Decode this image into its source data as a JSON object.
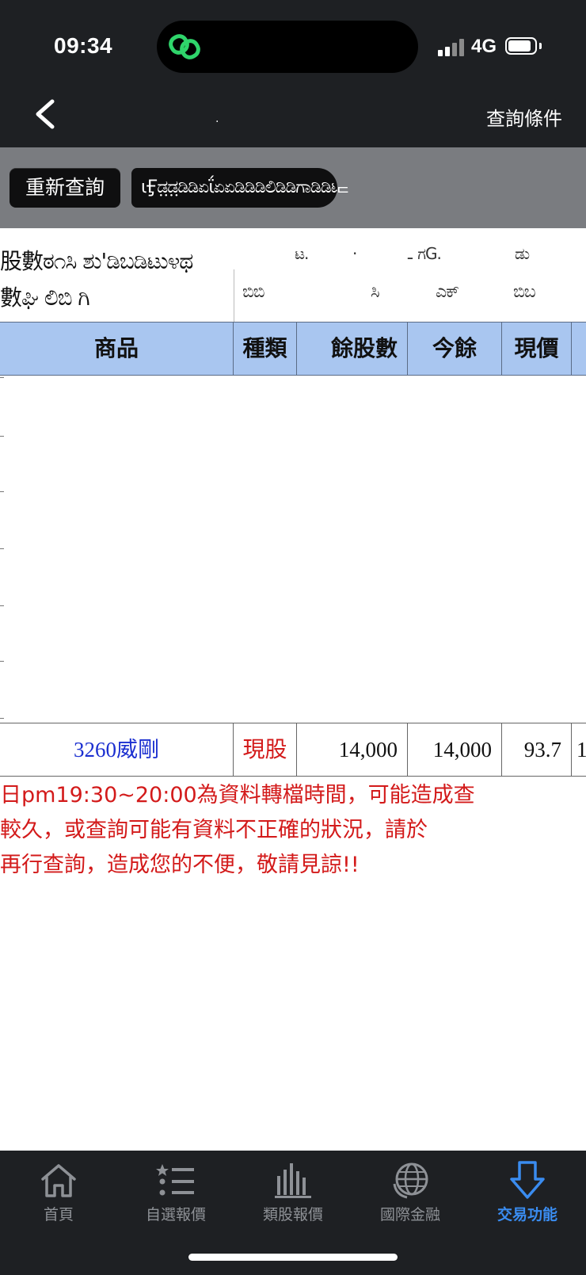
{
  "status_bar": {
    "time": "09:34",
    "network": "4G",
    "signal_icon": "signal-bars-icon",
    "battery_icon": "battery-icon",
    "app_icon": "link-chain-icon"
  },
  "nav": {
    "back_icon": "chevron-left-icon",
    "title": ".",
    "query_conditions": "查詢條件"
  },
  "actions": {
    "requery": "重新查詢",
    "account": "ιӺಡ಼ಡ಼ಡಿಡಿಏΐಏಏಡಿಡಿಡಿಲಿಡಿಡಿಗಾಡಿಡಿಟಿ",
    "account_tail": "ᄃ"
  },
  "summary": {
    "row1_left": "股數ಠ೧ಸಿ ಶು'ಡಿಬಡಿಟು೪ಥ",
    "row1_right": [
      "ಟ.",
      "·",
      "ـ ಗG.",
      "ಡು"
    ],
    "row2_left": "數ಘಿ  ಲಿಬಿ ಗಿ",
    "row2_right": [
      "ಬಿಬಿ",
      "ಸಿ",
      "ಎಕ್",
      "ಬಿಬ"
    ]
  },
  "table": {
    "headers": [
      "商品",
      "種類",
      "餘股數",
      "今餘",
      "現價",
      ""
    ],
    "rows": [
      {
        "product": "3260威剛",
        "kind": "現股",
        "remaining_shares": "14,000",
        "today_remaining": "14,000",
        "price": "93.7",
        "extra": "1"
      }
    ]
  },
  "notice": {
    "lines": [
      "日pm19:30~20:00為資料轉檔時間，可能造成查",
      "較久，或查詢可能有資料不正確的狀況，請於",
      "再行查詢，造成您的不便，敬請見諒!!"
    ]
  },
  "tabbar": {
    "items": [
      {
        "label": "首頁",
        "icon": "home-icon",
        "active": false
      },
      {
        "label": "自選報價",
        "icon": "star-list-icon",
        "active": false
      },
      {
        "label": "類股報價",
        "icon": "bar-chart-icon",
        "active": false
      },
      {
        "label": "國際金融",
        "icon": "globe-icon",
        "active": false
      },
      {
        "label": "交易功能",
        "icon": "down-arrow-icon",
        "active": true
      }
    ],
    "accent_color": "#3a8cf0"
  }
}
